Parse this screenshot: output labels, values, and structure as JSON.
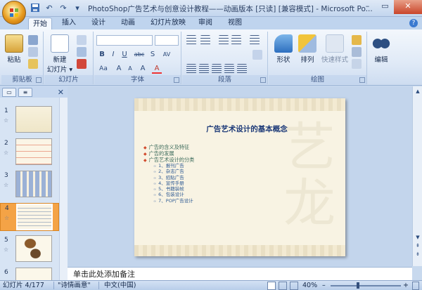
{
  "window": {
    "title": "PhotoShop广告艺术与创意设计教程——动画版本 [只读] [兼容模式] - Microsoft Po...",
    "minimize": "–",
    "maximize": "▭",
    "close": "✕"
  },
  "qat": {
    "save_icon": "save-icon",
    "undo_icon": "undo-icon",
    "redo_icon": "redo-icon",
    "more": "▾"
  },
  "tabs": [
    {
      "label": "开始",
      "active": true
    },
    {
      "label": "插入"
    },
    {
      "label": "设计"
    },
    {
      "label": "动画"
    },
    {
      "label": "幻灯片放映"
    },
    {
      "label": "审阅"
    },
    {
      "label": "视图"
    }
  ],
  "ribbon": {
    "clipboard": {
      "paste": "粘贴",
      "label": "剪贴板"
    },
    "slides": {
      "new_slide": "新建",
      "new_slide2": "幻灯片 ▾",
      "label": "幻灯片"
    },
    "font": {
      "label": "字体",
      "bold": "B",
      "italic": "I",
      "underline": "U",
      "strike": "abc",
      "shadow": "S",
      "spacing": "AV",
      "case": "Aa",
      "grow": "A",
      "shrink": "A",
      "clear": "A",
      "color": "A"
    },
    "paragraph": {
      "label": "段落"
    },
    "drawing": {
      "shapes": "形状",
      "arrange": "排列",
      "quick_styles": "快速样式",
      "label": "绘图"
    },
    "editing": {
      "edit": "编辑"
    }
  },
  "left_pane": {
    "close": "✕",
    "thumbnails": [
      {
        "num": "1"
      },
      {
        "num": "2"
      },
      {
        "num": "3"
      },
      {
        "num": "4",
        "selected": true
      },
      {
        "num": "5"
      },
      {
        "num": "6"
      }
    ]
  },
  "slide": {
    "title": "广告艺术设计的基本概念",
    "watermark": "艺\n龙",
    "bullets": [
      {
        "level": 1,
        "text": "广告的含义及特征"
      },
      {
        "level": 1,
        "text": "广告的发展"
      },
      {
        "level": 1,
        "text": "广告艺术设计的分类"
      },
      {
        "level": 2,
        "text": "1、报刊广告"
      },
      {
        "level": 2,
        "text": "2、杂志广告"
      },
      {
        "level": 2,
        "text": "3、招贴广告"
      },
      {
        "level": 2,
        "text": "4、宣传手册"
      },
      {
        "level": 2,
        "text": "5、书籍装帧"
      },
      {
        "level": 2,
        "text": "6、包装设计"
      },
      {
        "level": 2,
        "text": "7、POP广告设计"
      }
    ]
  },
  "notes": {
    "text": "单击此处添加备注"
  },
  "status": {
    "slide_info": "幻灯片 4/177",
    "theme": "\"诗情画意\"",
    "language": "中文(中国)",
    "zoom": "40%",
    "zoom_minus": "–",
    "zoom_plus": "+"
  }
}
